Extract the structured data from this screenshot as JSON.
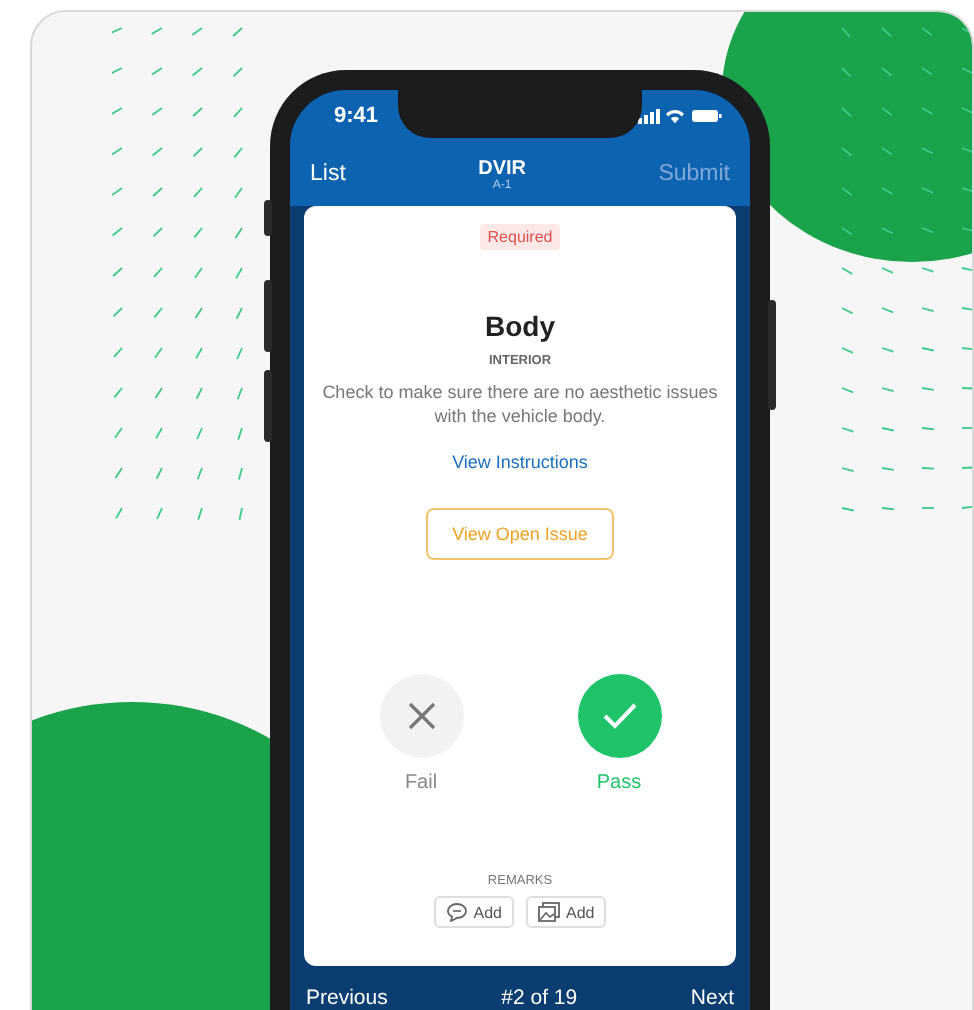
{
  "status_bar": {
    "time": "9:41"
  },
  "nav": {
    "back": "List",
    "title": "DVIR",
    "subtitle": "A-1",
    "action": "Submit",
    "action_disabled": true
  },
  "card": {
    "badge": "Required",
    "title": "Body",
    "category": "INTERIOR",
    "description": "Check to make sure there are no aesthetic issues with the vehicle body.",
    "link": "View Instructions",
    "issue_button": "View Open Issue",
    "choices": [
      {
        "kind": "fail",
        "label": "Fail",
        "selected": false
      },
      {
        "kind": "pass",
        "label": "Pass",
        "selected": true
      }
    ],
    "remarks": {
      "label": "REMARKS",
      "buttons": [
        {
          "kind": "comment",
          "label": "Add"
        },
        {
          "kind": "photo",
          "label": "Add"
        }
      ]
    }
  },
  "footer": {
    "previous": "Previous",
    "position": "#2 of 19",
    "next": "Next"
  }
}
